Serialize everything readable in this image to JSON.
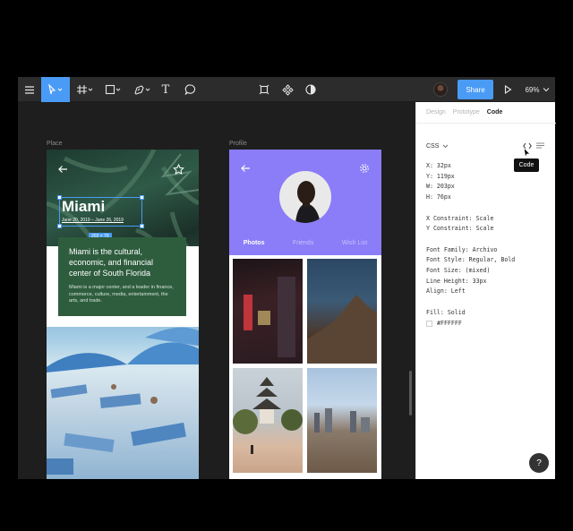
{
  "toolbar": {
    "share_label": "Share",
    "zoom_label": "69%",
    "text_tool_glyph": "T"
  },
  "canvas": {
    "frame_place_label": "Place",
    "frame_profile_label": "Profile"
  },
  "place_card": {
    "title": "Miami",
    "dates": "June 20, 2019 – June 26, 2019",
    "size_badge": "203 × 76",
    "headline": "Miami is the cultural, economic, and financial center of South Florida",
    "body": "Miami is a major center, and a leader in finance, commerce, culture, media, entertainment, the arts, and trade."
  },
  "profile_card": {
    "tabs": [
      "Photos",
      "Friends",
      "Wish List"
    ]
  },
  "panel": {
    "tabs": [
      "Design",
      "Prototype",
      "Code"
    ],
    "language": "CSS",
    "tooltip": "Code",
    "props": {
      "x": "X: 32px",
      "y": "Y: 119px",
      "w": "W: 203px",
      "h": "H: 76px",
      "constraint_x": "X Constraint: Scale",
      "constraint_y": "Y Constraint: Scale",
      "font_family": "Font Family: Archivo",
      "font_style": "Font Style: Regular, Bold",
      "font_size": "Font Size: (mixed)",
      "line_height": "Line Height: 33px",
      "align": "Align: Left",
      "fill": "Fill: Solid",
      "fill_hex": "#FFFFFF"
    },
    "help_label": "?"
  },
  "colors": {
    "accent": "#4a9bf5",
    "profile_purple": "#8b7cf8",
    "card_green": "#2e5d3e"
  }
}
